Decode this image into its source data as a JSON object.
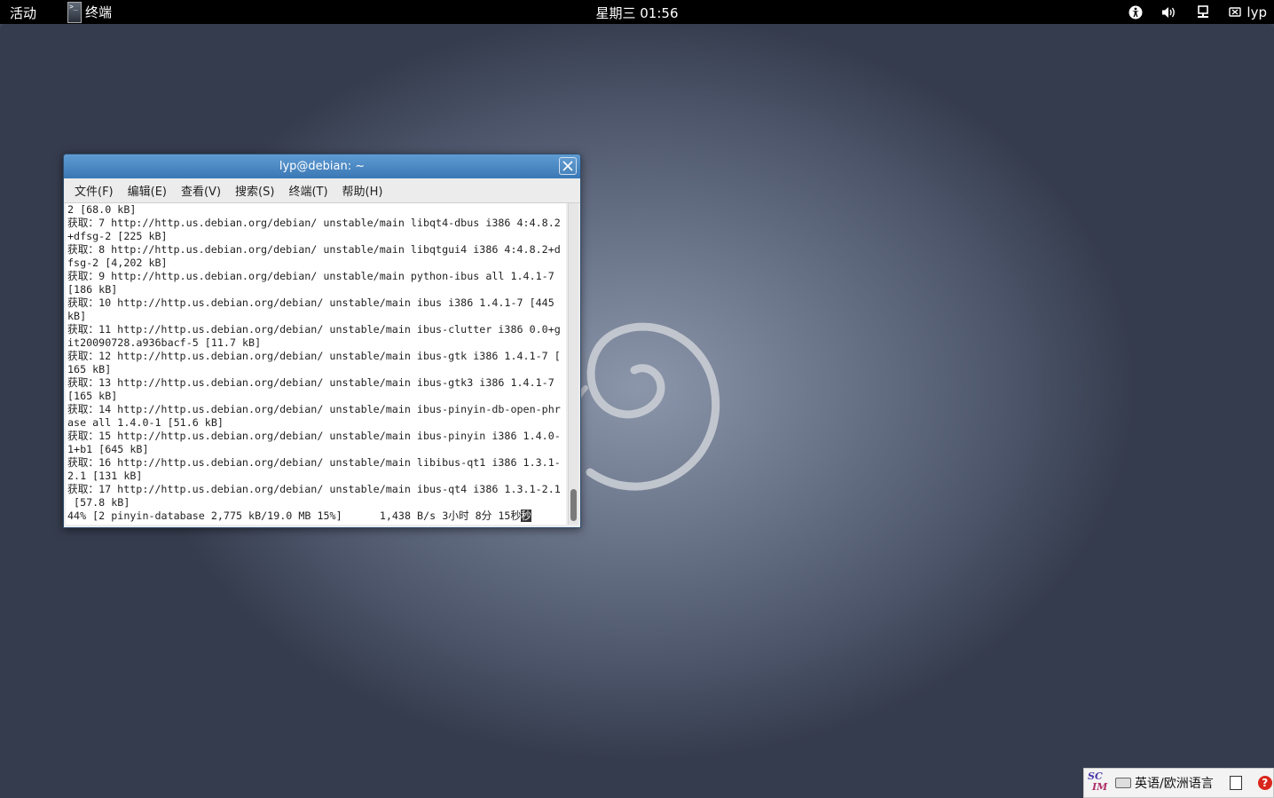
{
  "topbar": {
    "activities": "活动",
    "app_icon_glyph": ">_",
    "app_name": "终端",
    "clock": "星期三 01:56",
    "user": "lyp",
    "tray_icons": [
      "accessibility-icon",
      "volume-icon",
      "network-icon",
      "user-status-icon"
    ]
  },
  "terminal": {
    "title": "lyp@debian: ~",
    "menu": [
      "文件(F)",
      "编辑(E)",
      "查看(V)",
      "搜索(S)",
      "终端(T)",
      "帮助(H)"
    ],
    "lines": [
      "2 [68.0 kB]",
      "获取：7 http://http.us.debian.org/debian/ unstable/main libqt4-dbus i386 4:4.8.2",
      "+dfsg-2 [225 kB]",
      "获取：8 http://http.us.debian.org/debian/ unstable/main libqtgui4 i386 4:4.8.2+d",
      "fsg-2 [4,202 kB]",
      "获取：9 http://http.us.debian.org/debian/ unstable/main python-ibus all 1.4.1-7",
      "[186 kB]",
      "获取：10 http://http.us.debian.org/debian/ unstable/main ibus i386 1.4.1-7 [445",
      "kB]",
      "获取：11 http://http.us.debian.org/debian/ unstable/main ibus-clutter i386 0.0+g",
      "it20090728.a936bacf-5 [11.7 kB]",
      "获取：12 http://http.us.debian.org/debian/ unstable/main ibus-gtk i386 1.4.1-7 [",
      "165 kB]",
      "获取：13 http://http.us.debian.org/debian/ unstable/main ibus-gtk3 i386 1.4.1-7",
      "[165 kB]",
      "获取：14 http://http.us.debian.org/debian/ unstable/main ibus-pinyin-db-open-phr",
      "ase all 1.4.0-1 [51.6 kB]",
      "获取：15 http://http.us.debian.org/debian/ unstable/main ibus-pinyin i386 1.4.0-",
      "1+b1 [645 kB]",
      "获取：16 http://http.us.debian.org/debian/ unstable/main libibus-qt1 i386 1.3.1-",
      "2.1 [131 kB]",
      "获取：17 http://http.us.debian.org/debian/ unstable/main ibus-qt4 i386 1.3.1-2.1",
      " [57.8 kB]"
    ],
    "progress_line": "44% [2 pinyin-database 2,775 kB/19.0 MB 15%]      1,438 B/s 3小时 8分 15秒",
    "cursor_char": "秒"
  },
  "im_panel": {
    "logo_s": "SC",
    "logo_m": "IM",
    "language": "英语/欧洲语言",
    "help_glyph": "?"
  },
  "colors": {
    "titlebar": "#3a78b5",
    "topbar": "#000000",
    "desktop": "#6a7489"
  }
}
